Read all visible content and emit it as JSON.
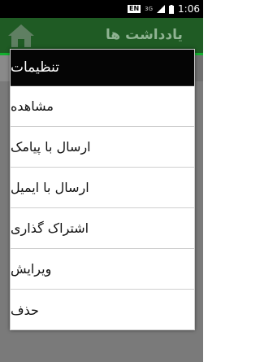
{
  "status_bar": {
    "language": "EN",
    "network": "3G",
    "battery": "▮",
    "time": "1:06"
  },
  "app_bar": {
    "title": "یادداشت ها",
    "logo_icon": "home-icon"
  },
  "dialog": {
    "title": "تنظیمات",
    "items": [
      {
        "label": "مشاهده"
      },
      {
        "label": "ارسال با پیامک"
      },
      {
        "label": "ارسال با ایمیل"
      },
      {
        "label": "اشتراک گذاری"
      },
      {
        "label": "ویرایش"
      },
      {
        "label": "حذف"
      }
    ]
  },
  "colors": {
    "app_bar": "#1f5b24",
    "accent": "#13b02f",
    "dialog_title_bg": "#050505"
  }
}
